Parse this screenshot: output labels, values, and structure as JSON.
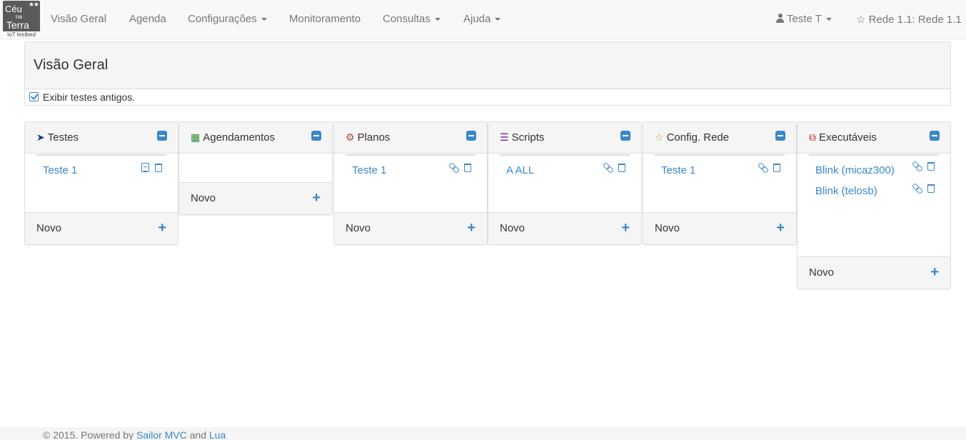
{
  "brand": {
    "line1": "Céu",
    "line2": "na",
    "line3": "Terra",
    "subtitle": "IoT testbed"
  },
  "nav": {
    "items": [
      {
        "label": "Visão Geral",
        "dropdown": false
      },
      {
        "label": "Agenda",
        "dropdown": false
      },
      {
        "label": "Configurações",
        "dropdown": true
      },
      {
        "label": "Monitoramento",
        "dropdown": false
      },
      {
        "label": "Consultas",
        "dropdown": true
      },
      {
        "label": "Ajuda",
        "dropdown": true
      }
    ],
    "user_label": "Teste T",
    "network_label": "Rede 1.1: Rede 1.1"
  },
  "overview": {
    "title": "Visão Geral",
    "show_old_tests_label": "Exibir testes antigos.",
    "show_old_tests_checked": true
  },
  "panels": [
    {
      "title": "Testes",
      "icon": "rocket-icon",
      "icon_color": "#1a3a8a",
      "items": [
        {
          "label": "Teste 1",
          "actions": [
            "document-icon",
            "trash-icon"
          ]
        }
      ],
      "footer_label": "Novo"
    },
    {
      "title": "Agendamentos",
      "icon": "calendar-icon",
      "icon_color": "#2e8b2e",
      "items": [],
      "footer_label": "Novo"
    },
    {
      "title": "Planos",
      "icon": "cogs-icon",
      "icon_color": "#a0522d",
      "items": [
        {
          "label": "Teste 1",
          "actions": [
            "link-icon",
            "trash-icon"
          ]
        }
      ],
      "footer_label": "Novo"
    },
    {
      "title": "Scripts",
      "icon": "list-icon",
      "icon_color": "#7b1fa2",
      "items": [
        {
          "label": "A ALL",
          "actions": [
            "link-icon",
            "trash-icon"
          ]
        }
      ],
      "footer_label": "Novo"
    },
    {
      "title": "Config. Rede",
      "icon": "star-icon",
      "icon_color": "#d4a017",
      "items": [
        {
          "label": "Teste 1",
          "actions": [
            "link-icon",
            "trash-icon"
          ]
        }
      ],
      "footer_label": "Novo"
    },
    {
      "title": "Executáveis",
      "icon": "copy-icon",
      "icon_color": "#c62828",
      "items": [
        {
          "label": "Blink (micaz300)",
          "actions": [
            "link-icon",
            "trash-icon"
          ]
        },
        {
          "label": "Blink (telosb)",
          "actions": [
            "link-icon",
            "trash-icon"
          ]
        }
      ],
      "footer_label": "Novo"
    }
  ],
  "footer": {
    "prefix": "© 2015. Powered by ",
    "link1": "Sailor MVC",
    "middle": " and ",
    "link2": "Lua"
  },
  "colors": {
    "accent": "#3a87c8",
    "navbar_bg": "#f8f8f8",
    "panel_header_bg": "#f5f5f5"
  }
}
